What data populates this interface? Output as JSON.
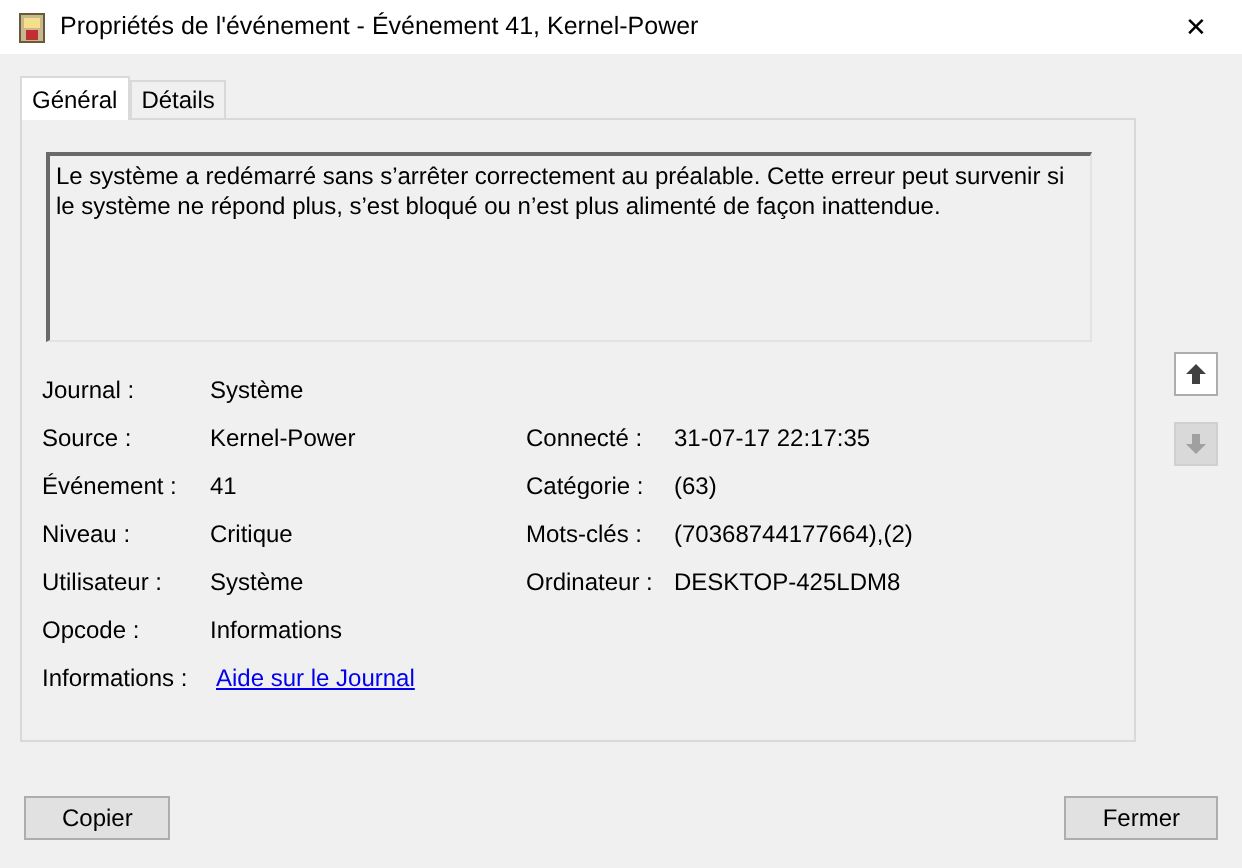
{
  "window": {
    "title": "Propriétés de l'événement - Événement 41, Kernel-Power",
    "close": "✕"
  },
  "tabs": [
    {
      "label": "Général",
      "selected": true
    },
    {
      "label": "Détails",
      "selected": false
    }
  ],
  "description": "Le système a redémarré sans s’arrêter correctement au préalable. Cette erreur peut survenir si le système ne répond plus, s’est bloqué ou n’est plus alimenté de façon inattendue.",
  "fields_left": [
    {
      "label": "Journal :",
      "value": "Système",
      "kind": "text"
    },
    {
      "label": "Source :",
      "value": "Kernel-Power",
      "kind": "text"
    },
    {
      "label": "Événement :",
      "value": "41",
      "kind": "text"
    },
    {
      "label": "Niveau :",
      "value": "Critique",
      "kind": "text"
    },
    {
      "label": "Utilisateur :",
      "value": "Système",
      "kind": "text"
    },
    {
      "label": "Opcode :",
      "value": "Informations",
      "kind": "text"
    },
    {
      "label": "Informations :",
      "value": "Aide sur le Journal",
      "kind": "link"
    }
  ],
  "fields_right": [
    {
      "label": "Connecté :",
      "value": "31-07-17 22:17:35"
    },
    {
      "label": "Catégorie :",
      "value": "(63)"
    },
    {
      "label": "Mots-clés :",
      "value": "(70368744177664),(2)"
    },
    {
      "label": "Ordinateur :",
      "value": "DESKTOP-425LDM8"
    }
  ],
  "nav": [
    {
      "kind": "up",
      "disabled": false
    },
    {
      "kind": "down",
      "disabled": true
    }
  ],
  "buttons": [
    {
      "label": "Copier"
    },
    {
      "label": "Fermer"
    }
  ]
}
